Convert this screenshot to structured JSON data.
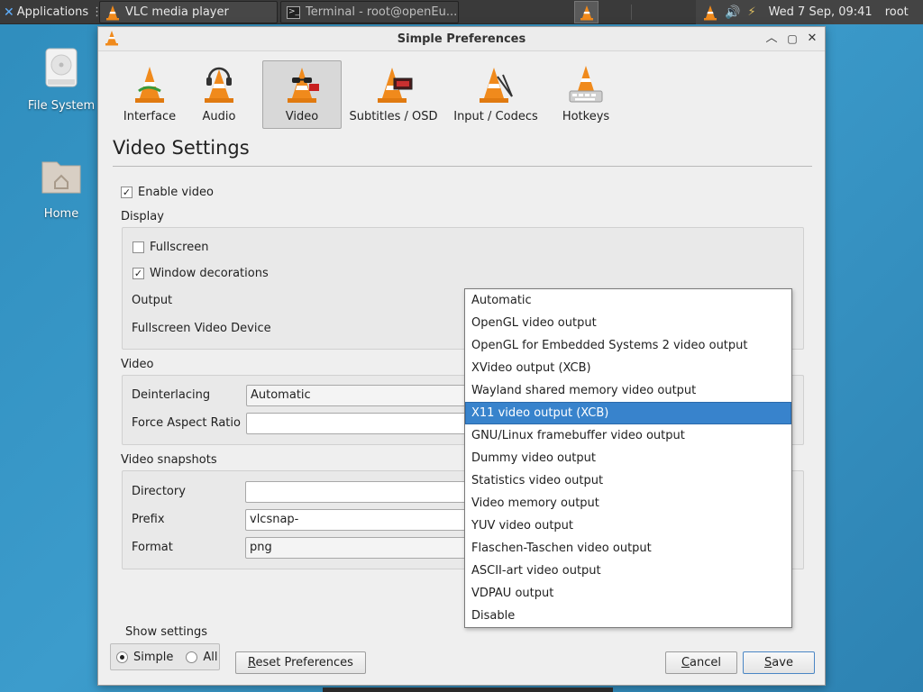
{
  "taskbar": {
    "apps_label": "Applications",
    "windows": [
      {
        "label": "VLC media player"
      },
      {
        "label": "Terminal - root@openEu..."
      }
    ],
    "clock": "Wed  7 Sep, 09:41",
    "user": "root"
  },
  "desktop": {
    "icons": [
      {
        "label": "File System"
      },
      {
        "label": "Home"
      }
    ]
  },
  "dialog": {
    "title": "Simple Preferences",
    "tabs": [
      {
        "label": "Interface",
        "selected": false
      },
      {
        "label": "Audio",
        "selected": false
      },
      {
        "label": "Video",
        "selected": true
      },
      {
        "label": "Subtitles / OSD",
        "selected": false
      },
      {
        "label": "Input / Codecs",
        "selected": false
      },
      {
        "label": "Hotkeys",
        "selected": false
      }
    ],
    "section_title": "Video Settings",
    "enable_video": {
      "label": "Enable video",
      "checked": true
    },
    "display": {
      "label": "Display",
      "fullscreen": {
        "label": "Fullscreen",
        "checked": false
      },
      "window_decorations": {
        "label": "Window decorations",
        "checked": true
      },
      "output_label": "Output",
      "fullscreen_device_label": "Fullscreen Video Device"
    },
    "video": {
      "label": "Video",
      "deinterlacing_label": "Deinterlacing",
      "deinterlacing_value": "Automatic",
      "aspect_label": "Force Aspect Ratio",
      "aspect_value": ""
    },
    "snapshots": {
      "label": "Video snapshots",
      "directory_label": "Directory",
      "directory_value": "",
      "prefix_label": "Prefix",
      "prefix_value": "vlcsnap-",
      "format_label": "Format",
      "format_value": "png"
    },
    "output_dropdown": {
      "options": [
        "Automatic",
        "OpenGL video output",
        "OpenGL for Embedded Systems 2 video output",
        "XVideo output (XCB)",
        "Wayland shared memory video output",
        "X11 video output (XCB)",
        "GNU/Linux framebuffer video output",
        "Dummy video output",
        "Statistics video output",
        "Video memory output",
        "YUV video output",
        "Flaschen-Taschen video output",
        "ASCII-art video output",
        "VDPAU output",
        "Disable"
      ],
      "selected": "X11 video output (XCB)"
    },
    "show_settings": {
      "label": "Show settings",
      "simple": {
        "label": "Simple",
        "selected": true
      },
      "all": {
        "label": "All",
        "selected": false
      }
    },
    "buttons": {
      "reset_first": "R",
      "reset_rest": "eset Preferences",
      "cancel_first": "C",
      "cancel_rest": "ancel",
      "save_first": "S",
      "save_rest": "ave"
    }
  },
  "colors": {
    "desktop": "#2f8dbd",
    "selection": "#3883cc",
    "cone_orange": "#f08a1c"
  }
}
